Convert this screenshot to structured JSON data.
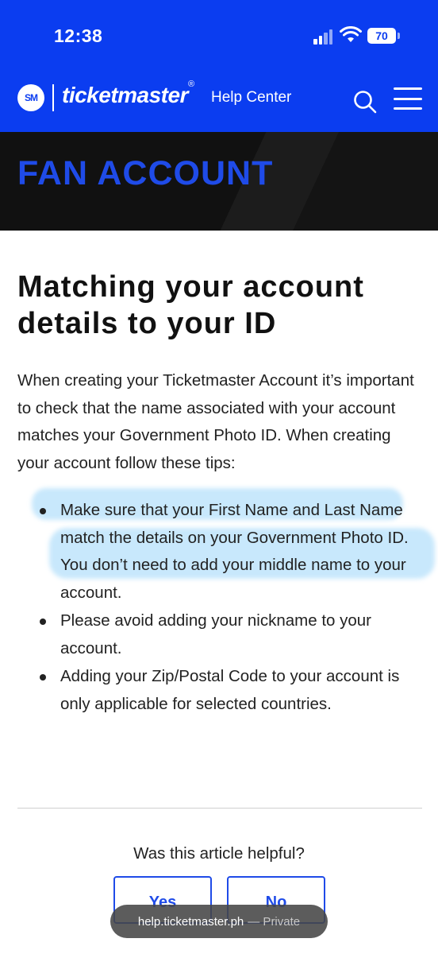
{
  "status_bar": {
    "time": "12:38",
    "battery": "70",
    "icons": [
      "signal-icon",
      "wifi-icon",
      "battery-icon"
    ]
  },
  "nav": {
    "logo_text": "SM",
    "brand": "ticketmaster",
    "brand_mark": "®",
    "section": "Help Center",
    "icons": [
      "search-icon",
      "menu-icon"
    ]
  },
  "hero": {
    "title": "FAN ACCOUNT"
  },
  "article": {
    "title": "Matching your account details to your ID",
    "intro": "When creating your Ticketmaster Account it’s important to check that the name associated with your account matches your Government Photo ID. When creating your account follow these tips:",
    "tips": [
      "Make sure that your First Name and Last Name match the details on your Government Photo ID. You don’t need to add your middle name to your account.",
      "Please avoid adding your nickname to your account.",
      "Adding your Zip/Postal Code to your account is only applicable for selected countries."
    ]
  },
  "feedback": {
    "question": "Was this article helpful?",
    "yes_label": "Yes",
    "no_label": "No"
  },
  "browser": {
    "url": "help.ticketmaster.ph",
    "privacy": "— Private"
  },
  "colors": {
    "brand_blue": "#0b3df0",
    "hero_text": "#1f4be8",
    "hero_bg": "#111111",
    "highlight": "#62bef6"
  }
}
